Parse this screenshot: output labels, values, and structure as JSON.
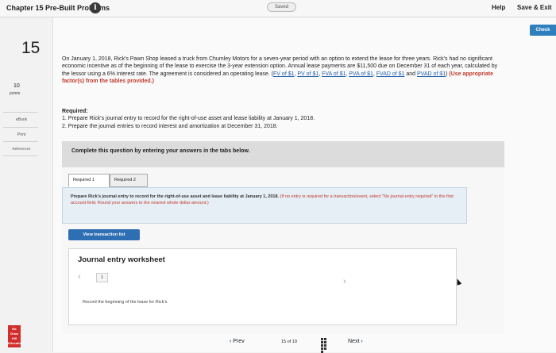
{
  "topbar": {
    "title": "Chapter 15 Pre-Built Problems",
    "info_icon": "i",
    "saved": "Saved",
    "help": "Help",
    "save_exit": "Save & Exit"
  },
  "check_label": "Check",
  "question": {
    "number": "15",
    "points_value": "10",
    "points_label": "points"
  },
  "rail": {
    "ebook": "eBook",
    "print": "Print",
    "references": "References"
  },
  "problem": {
    "text": "On January 1, 2018, Rick's Pawn Shop leased a truck from Chumley Motors for a seven-year period with an option to extend the lease for three years. Rick's had no significant economic incentive as of the beginning of the lease to exercise the 3-year extension option. Annual lease payments are $11,500 due on December 31 of each year, calculated by the lessor using a 6% interest rate. The agreement is considered an operating lease.",
    "links": [
      "FV of $1",
      "PV of $1",
      "FVA of $1",
      "PVA of $1",
      "FVAD of $1",
      "PVAD of $1"
    ],
    "use_note": "(Use appropriate factor(s) from the tables provided.)"
  },
  "required": {
    "title": "Required:",
    "item1": "1. Prepare Rick's journal entry to record for the right-of-use asset and lease liability at January 1, 2018.",
    "item2": "2. Prepare the journal entries to record interest and amortization at December 31, 2018."
  },
  "instruction": "Complete this question by entering your answers in the tabs below.",
  "tabs": [
    "Required 1",
    "Required 2"
  ],
  "prompt": {
    "main": "Prepare Rick's journal entry to record for the right-of-use asset and lease liability at January 1, 2018.",
    "note": "(If no entry is required for a transaction/event, select \"No journal entry required\" in the first account field. Round your answers to the nearest whole dollar amount.)"
  },
  "view_transaction_button": "View transaction list",
  "worksheet": {
    "title": "Journal entry worksheet",
    "page": "1",
    "note": "Record the beginning of the lease for Rick's."
  },
  "nav": {
    "prev": "Prev",
    "current": "15",
    "of": "of",
    "total": "19",
    "next": "Next"
  },
  "logo": {
    "text": "Mc Graw Hill Education"
  }
}
